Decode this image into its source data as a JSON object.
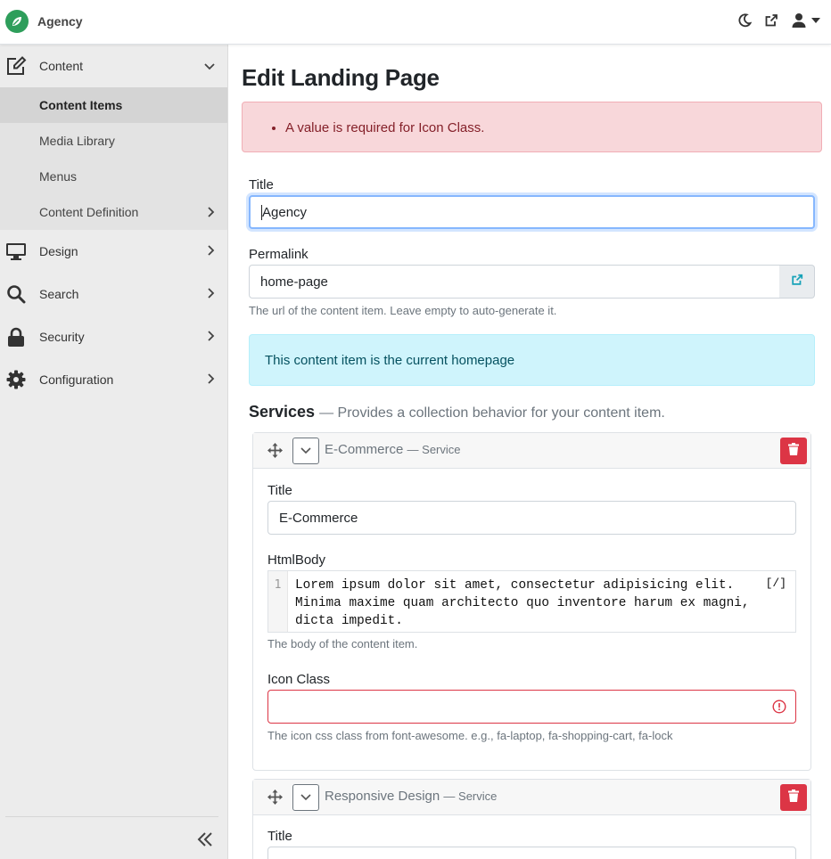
{
  "app": {
    "name": "Agency"
  },
  "topbar": {
    "icons": [
      "moon-icon",
      "external-link-icon",
      "user-icon",
      "caret-down-icon"
    ]
  },
  "sidebar": {
    "content": {
      "label": "Content",
      "items": [
        {
          "label": "Content Items"
        },
        {
          "label": "Media Library"
        },
        {
          "label": "Menus"
        },
        {
          "label": "Content Definition"
        }
      ]
    },
    "items": [
      {
        "label": "Design",
        "icon": "monitor-icon"
      },
      {
        "label": "Search",
        "icon": "search-icon"
      },
      {
        "label": "Security",
        "icon": "lock-icon"
      },
      {
        "label": "Configuration",
        "icon": "gear-icon"
      }
    ]
  },
  "page": {
    "title": "Edit Landing Page"
  },
  "errors": [
    "A value is required for Icon Class."
  ],
  "form": {
    "title": {
      "label": "Title",
      "value": "Agency"
    },
    "permalink": {
      "label": "Permalink",
      "value": "home-page",
      "hint": "The url of the content item. Leave empty to auto-generate it."
    },
    "homepage_notice": "This content item is the current homepage"
  },
  "services": {
    "heading": "Services",
    "description": "— Provides a collection behavior for your content item.",
    "items": [
      {
        "name": "E-Commerce",
        "type": "— Service",
        "title_label": "Title",
        "title_value": "E-Commerce",
        "htmlbody_label": "HtmlBody",
        "htmlbody_line_number": "1",
        "htmlbody_value": "Lorem ipsum dolor sit amet, consectetur adipisicing elit.\nMinima maxime quam architecto quo inventore harum ex magni,\ndicta impedit.",
        "htmlbody_toggle": "[/]",
        "htmlbody_hint": "The body of the content item.",
        "icon_class_label": "Icon Class",
        "icon_class_value": "",
        "icon_class_hint": "The icon css class from font-awesome. e.g., fa-laptop, fa-shopping-cart, fa-lock"
      },
      {
        "name": "Responsive Design",
        "type": "— Service",
        "title_label": "Title"
      }
    ]
  },
  "colors": {
    "danger": "#dc3545",
    "info_bg": "#cff4fc",
    "sidebar_bg": "#ececec",
    "brand": "#2e9e5b"
  }
}
